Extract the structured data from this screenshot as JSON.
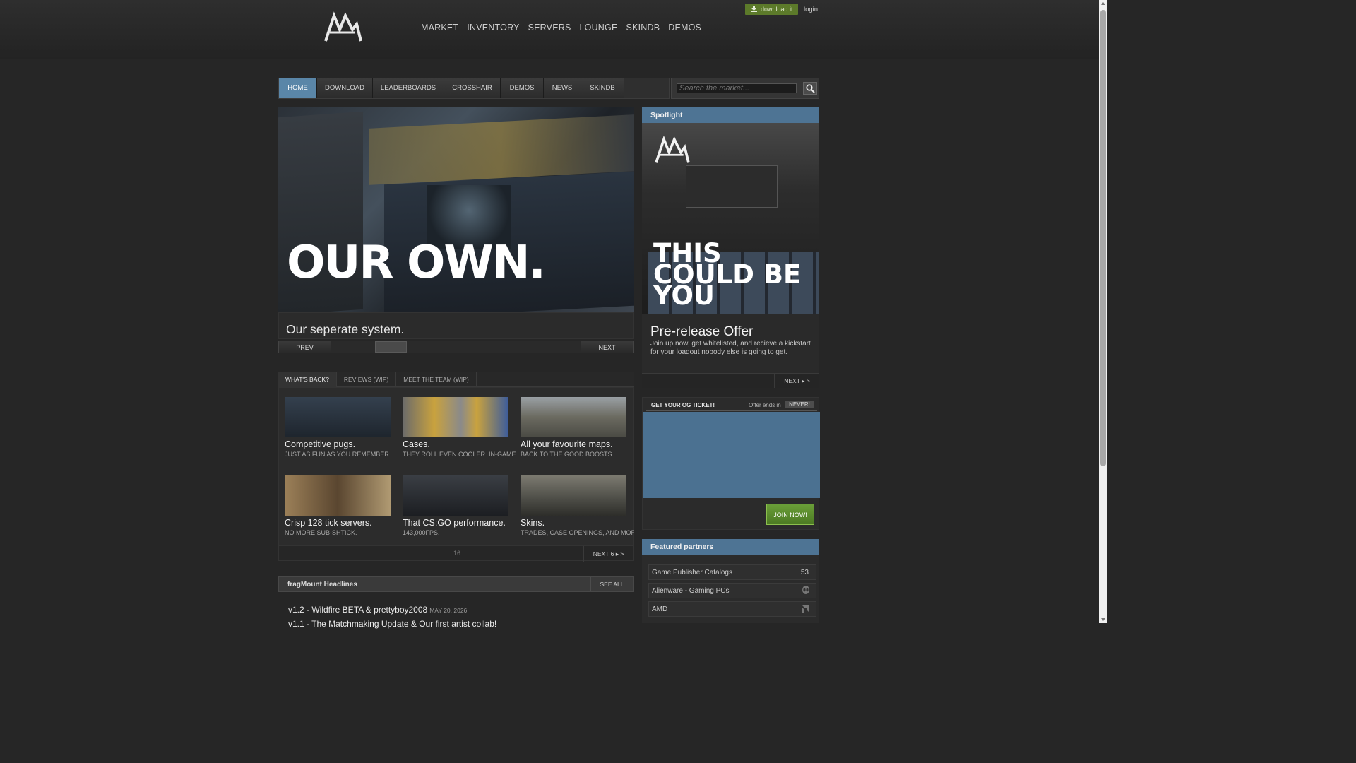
{
  "header": {
    "logo_name": "fragmount-logo",
    "nav": [
      "MARKET",
      "INVENTORY",
      "SERVERS",
      "LOUNGE",
      "SKINDB",
      "DEMOS"
    ],
    "download_label": "download it",
    "login_label": "login"
  },
  "mainnav": {
    "tabs": [
      "HOME",
      "DOWNLOAD",
      "LEADERBOARDS",
      "CROSSHAIR",
      "DEMOS",
      "NEWS",
      "SKINDB"
    ],
    "active": "HOME"
  },
  "search": {
    "placeholder": "Search the market..."
  },
  "hero": {
    "overlay_text": "OUR OWN.",
    "caption": "Our seperate system.",
    "prev_label": "PREV",
    "next_label": "NEXT"
  },
  "features": {
    "tabs": [
      "WHAT'S BACK?",
      "REVIEWS (WIP)",
      "MEET THE TEAM (WIP)"
    ],
    "items": [
      {
        "title": "Competitive pugs.",
        "subtitle": "JUST AS FUN AS YOU REMEMBER."
      },
      {
        "title": "Cases.",
        "subtitle": "THEY ROLL EVEN COOLER. IN-GAME"
      },
      {
        "title": "All your favourite maps.",
        "subtitle": "BACK TO THE GOOD BOOSTS."
      },
      {
        "title": "Crisp 128 tick servers.",
        "subtitle": "NO MORE SUB-SHTICK."
      },
      {
        "title": "That CS:GO performance.",
        "subtitle": "143,000FPS."
      },
      {
        "title": "Skins.",
        "subtitle": "TRADES, CASE OPENINGS, AND MORE"
      }
    ],
    "page_number": "16",
    "next_label": "NEXT 6"
  },
  "headlines": {
    "title": "fragMount Headlines",
    "see_all": "SEE ALL",
    "items": [
      {
        "title": "v1.2 - Wildfire BETA & prettyboy2008",
        "date": "MAY 20, 2026"
      },
      {
        "title": "v1.1 - The Matchmaking Update & Our first artist collab!",
        "date": ""
      }
    ]
  },
  "spotlight": {
    "header": "Spotlight",
    "image_text": "THIS COULD BE YOU",
    "title": "Pre-release Offer",
    "description": "Join up now, get whitelisted, and recieve a kickstart for your loadout nobody else is going to get.",
    "next_label": "NEXT"
  },
  "og_ticket": {
    "title": "GET YOUR OG TICKET!",
    "offer_label": "Offer ends in",
    "offer_value": "NEVER!",
    "join_label": "JOIN NOW!"
  },
  "partners": {
    "header": "Featured partners",
    "items": [
      {
        "name": "Game Publisher Catalogs",
        "count": "53",
        "icon": ""
      },
      {
        "name": "Alienware - Gaming PCs",
        "count": "",
        "icon": "alien-icon"
      },
      {
        "name": "AMD",
        "count": "",
        "icon": "amd-icon"
      }
    ]
  },
  "colors": {
    "accent_blue": "#5a86a8",
    "header_blue": "#4e7494",
    "download_green": "#5c7a2a",
    "join_green": "#5e8f2f"
  }
}
